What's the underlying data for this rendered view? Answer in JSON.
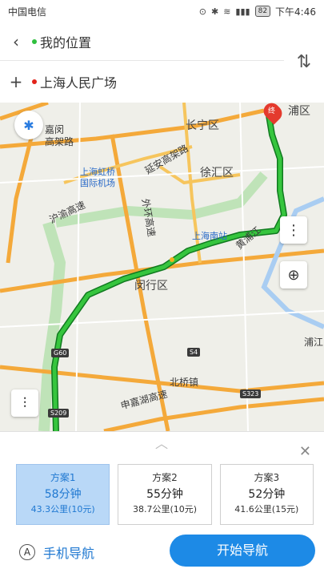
{
  "status_bar": {
    "carrier": "中国电信",
    "battery": "82",
    "time": "下午4:46"
  },
  "route": {
    "from": "我的位置",
    "to": "上海人民广场"
  },
  "map": {
    "labels": {
      "changning": "长宁区",
      "huangpu": "浦区",
      "xuhui": "徐汇区",
      "yanan": "延安高架路",
      "hongqiao": "上海虹桥",
      "hongqiao2": "国际机场",
      "jiamin1": "嘉闵",
      "jiamin2": "高架路",
      "hu_yu": "沪渝高速",
      "waihuan": "外环高速",
      "shanghai_south": "上海南站",
      "minhang": "闵行区",
      "beiqiao": "北桥镇",
      "jiaxing": "申嘉湖高速",
      "puqiang": "浦江",
      "huanghuang": "黄浦江",
      "g60": "G60",
      "s4": "S4",
      "s323": "S323",
      "s209": "S209",
      "end": "终"
    }
  },
  "plans": [
    {
      "name": "方案1",
      "time": "58分钟",
      "detail": "43.3公里(10元)"
    },
    {
      "name": "方案2",
      "time": "55分钟",
      "detail": "38.7公里(10元)"
    },
    {
      "name": "方案3",
      "time": "52分钟",
      "detail": "41.6公里(15元)"
    }
  ],
  "actions": {
    "phone_nav": "手机导航",
    "phone_nav_icon_letter": "A",
    "start_nav": "开始导航"
  }
}
